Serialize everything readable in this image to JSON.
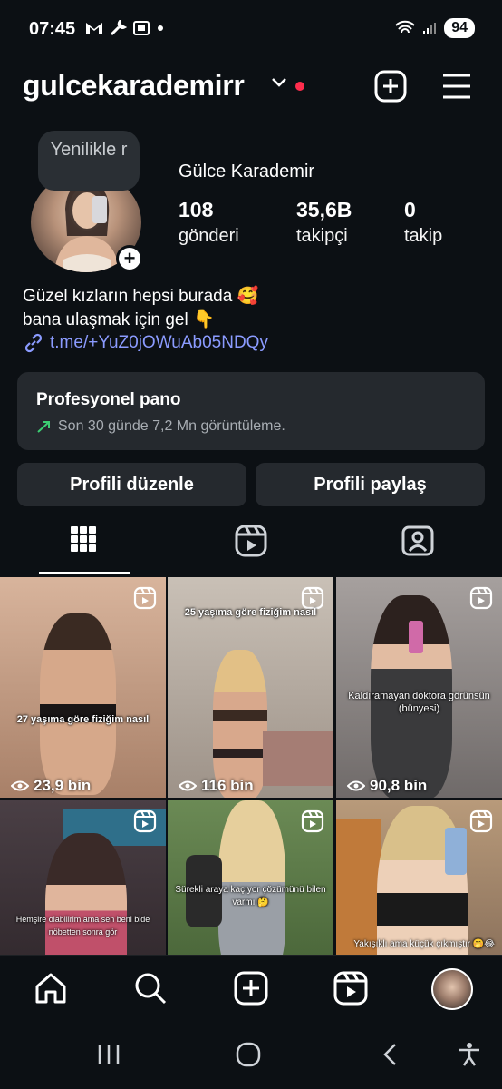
{
  "status_bar": {
    "time": "07:45",
    "icons": [
      "gmail-icon",
      "wrench-icon",
      "screenshot-icon",
      "dot-icon"
    ],
    "battery": "94"
  },
  "header": {
    "username": "gulcekarademirr",
    "has_notification_dot": true
  },
  "profile": {
    "notes_bubble": "Yenilikle r",
    "full_name": "Gülce Karademir",
    "stats": [
      {
        "value": "108",
        "label": "gönderi"
      },
      {
        "value": "35,6B",
        "label": "takipçi"
      },
      {
        "value": "0",
        "label": "takip"
      }
    ],
    "bio_line1": "Güzel kızların hepsi burada 🥰",
    "bio_line2": "bana ulaşmak için gel 👇",
    "link": "t.me/+YuZ0jOWuAb05NDQy"
  },
  "dashboard": {
    "title": "Profesyonel pano",
    "subtitle": "Son 30 günde 7,2 Mn görüntüleme."
  },
  "buttons": {
    "edit_profile": "Profili düzenle",
    "share_profile": "Profili paylaş"
  },
  "tabs": [
    "grid-icon",
    "reels-icon",
    "tagged-icon"
  ],
  "posts": [
    {
      "caption": "27 yaşıma göre fiziğim nasıl",
      "views": "23,9 bin",
      "bg": "#c9a28a"
    },
    {
      "caption": "25 yaşıma göre fiziğim nasıl",
      "views": "116 bin",
      "bg": "#b9b0a6"
    },
    {
      "caption": "Kaldıramayan doktora görünsün (bünyesi)",
      "views": "90,8 bin",
      "bg": "#8f8a88"
    },
    {
      "caption": "Hemşire olabilirim ama sen beni bide nöbetten sonra gör",
      "views": "",
      "bg": "#3b3438"
    },
    {
      "caption": "Sürekli araya kaçıyor çözümünü bilen varmı 🤔",
      "views": "",
      "bg": "#5d7a4a"
    },
    {
      "caption": "Yakışıklı ama küçük çıkmıştır 🤭😂",
      "views": "",
      "bg": "#b59a7c"
    }
  ],
  "bottom_nav": [
    "home-icon",
    "search-icon",
    "create-icon",
    "reels-icon",
    "profile-avatar"
  ],
  "system_nav": [
    "recents-icon",
    "home-circle-icon",
    "back-icon",
    "accessibility-icon"
  ]
}
